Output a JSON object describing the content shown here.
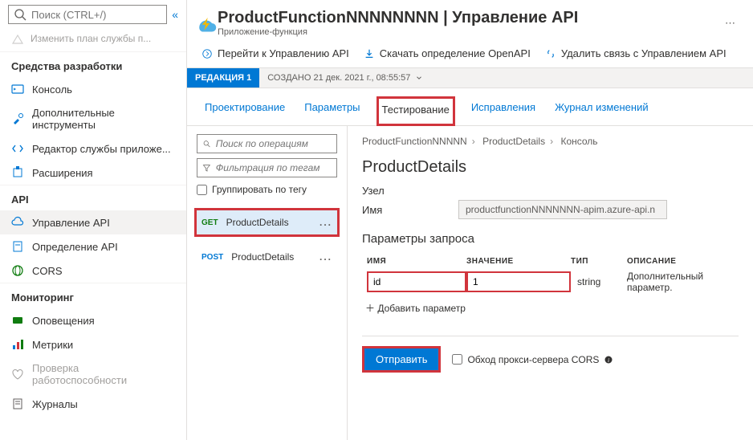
{
  "header": {
    "title": "ProductFunctionNNNNNNNN | Управление API",
    "subtitle": "Приложение-функция"
  },
  "sidebar": {
    "search_ph": "Поиск (CTRL+/)",
    "plan": "Изменить план службы п...",
    "sections": {
      "dev": "Средства разработки",
      "api": "API",
      "mon": "Мониторинг"
    },
    "items": {
      "console": "Консоль",
      "advtools": "Дополнительные инструменты",
      "appeditor": "Редактор службы приложе...",
      "ext": "Расширения",
      "apimgmt": "Управление API",
      "apidef": "Определение API",
      "cors": "CORS",
      "alerts": "Оповещения",
      "metrics": "Метрики",
      "health": "Проверка работоспособности",
      "logs": "Журналы"
    }
  },
  "toolbar": {
    "goto": "Перейти к Управлению API",
    "dl": "Скачать определение OpenAPI",
    "unlink": "Удалить связь с Управлением API"
  },
  "revbar": {
    "chip": "РЕДАКЦИЯ 1",
    "meta": "СОЗДАНО 21 дек. 2021 г., 08:55:57"
  },
  "tabs": {
    "design": "Проектирование",
    "params": "Параметры",
    "test": "Тестирование",
    "fixes": "Исправления",
    "changelog": "Журнал изменений"
  },
  "ops": {
    "search_ph": "Поиск по операциям",
    "filter_ph": "Фильтрация по тегам",
    "group_label": "Группировать по тегу",
    "op1_verb": "GET",
    "op1_name": "ProductDetails",
    "op2_verb": "POST",
    "op2_name": "ProductDetails"
  },
  "breadcrumb": {
    "a": "ProductFunctionNNNNN",
    "b": "ProductDetails",
    "c": "Консоль"
  },
  "detail": {
    "title": "ProductDetails",
    "node": "Узел",
    "name_lbl": "Имя",
    "name_val": "productfunctionNNNNNNN-apim.azure-api.n",
    "params_title": "Параметры запроса",
    "col_name": "ИМЯ",
    "col_val": "ЗНАЧЕНИЕ",
    "col_type": "ТИП",
    "col_desc": "ОПИСАНИЕ",
    "p_name": "id",
    "p_val": "1",
    "p_type": "string",
    "p_desc": "Дополнительный параметр.",
    "add_param": "Добавить параметр",
    "send": "Отправить",
    "cors": "Обход прокси-сервера CORS"
  }
}
